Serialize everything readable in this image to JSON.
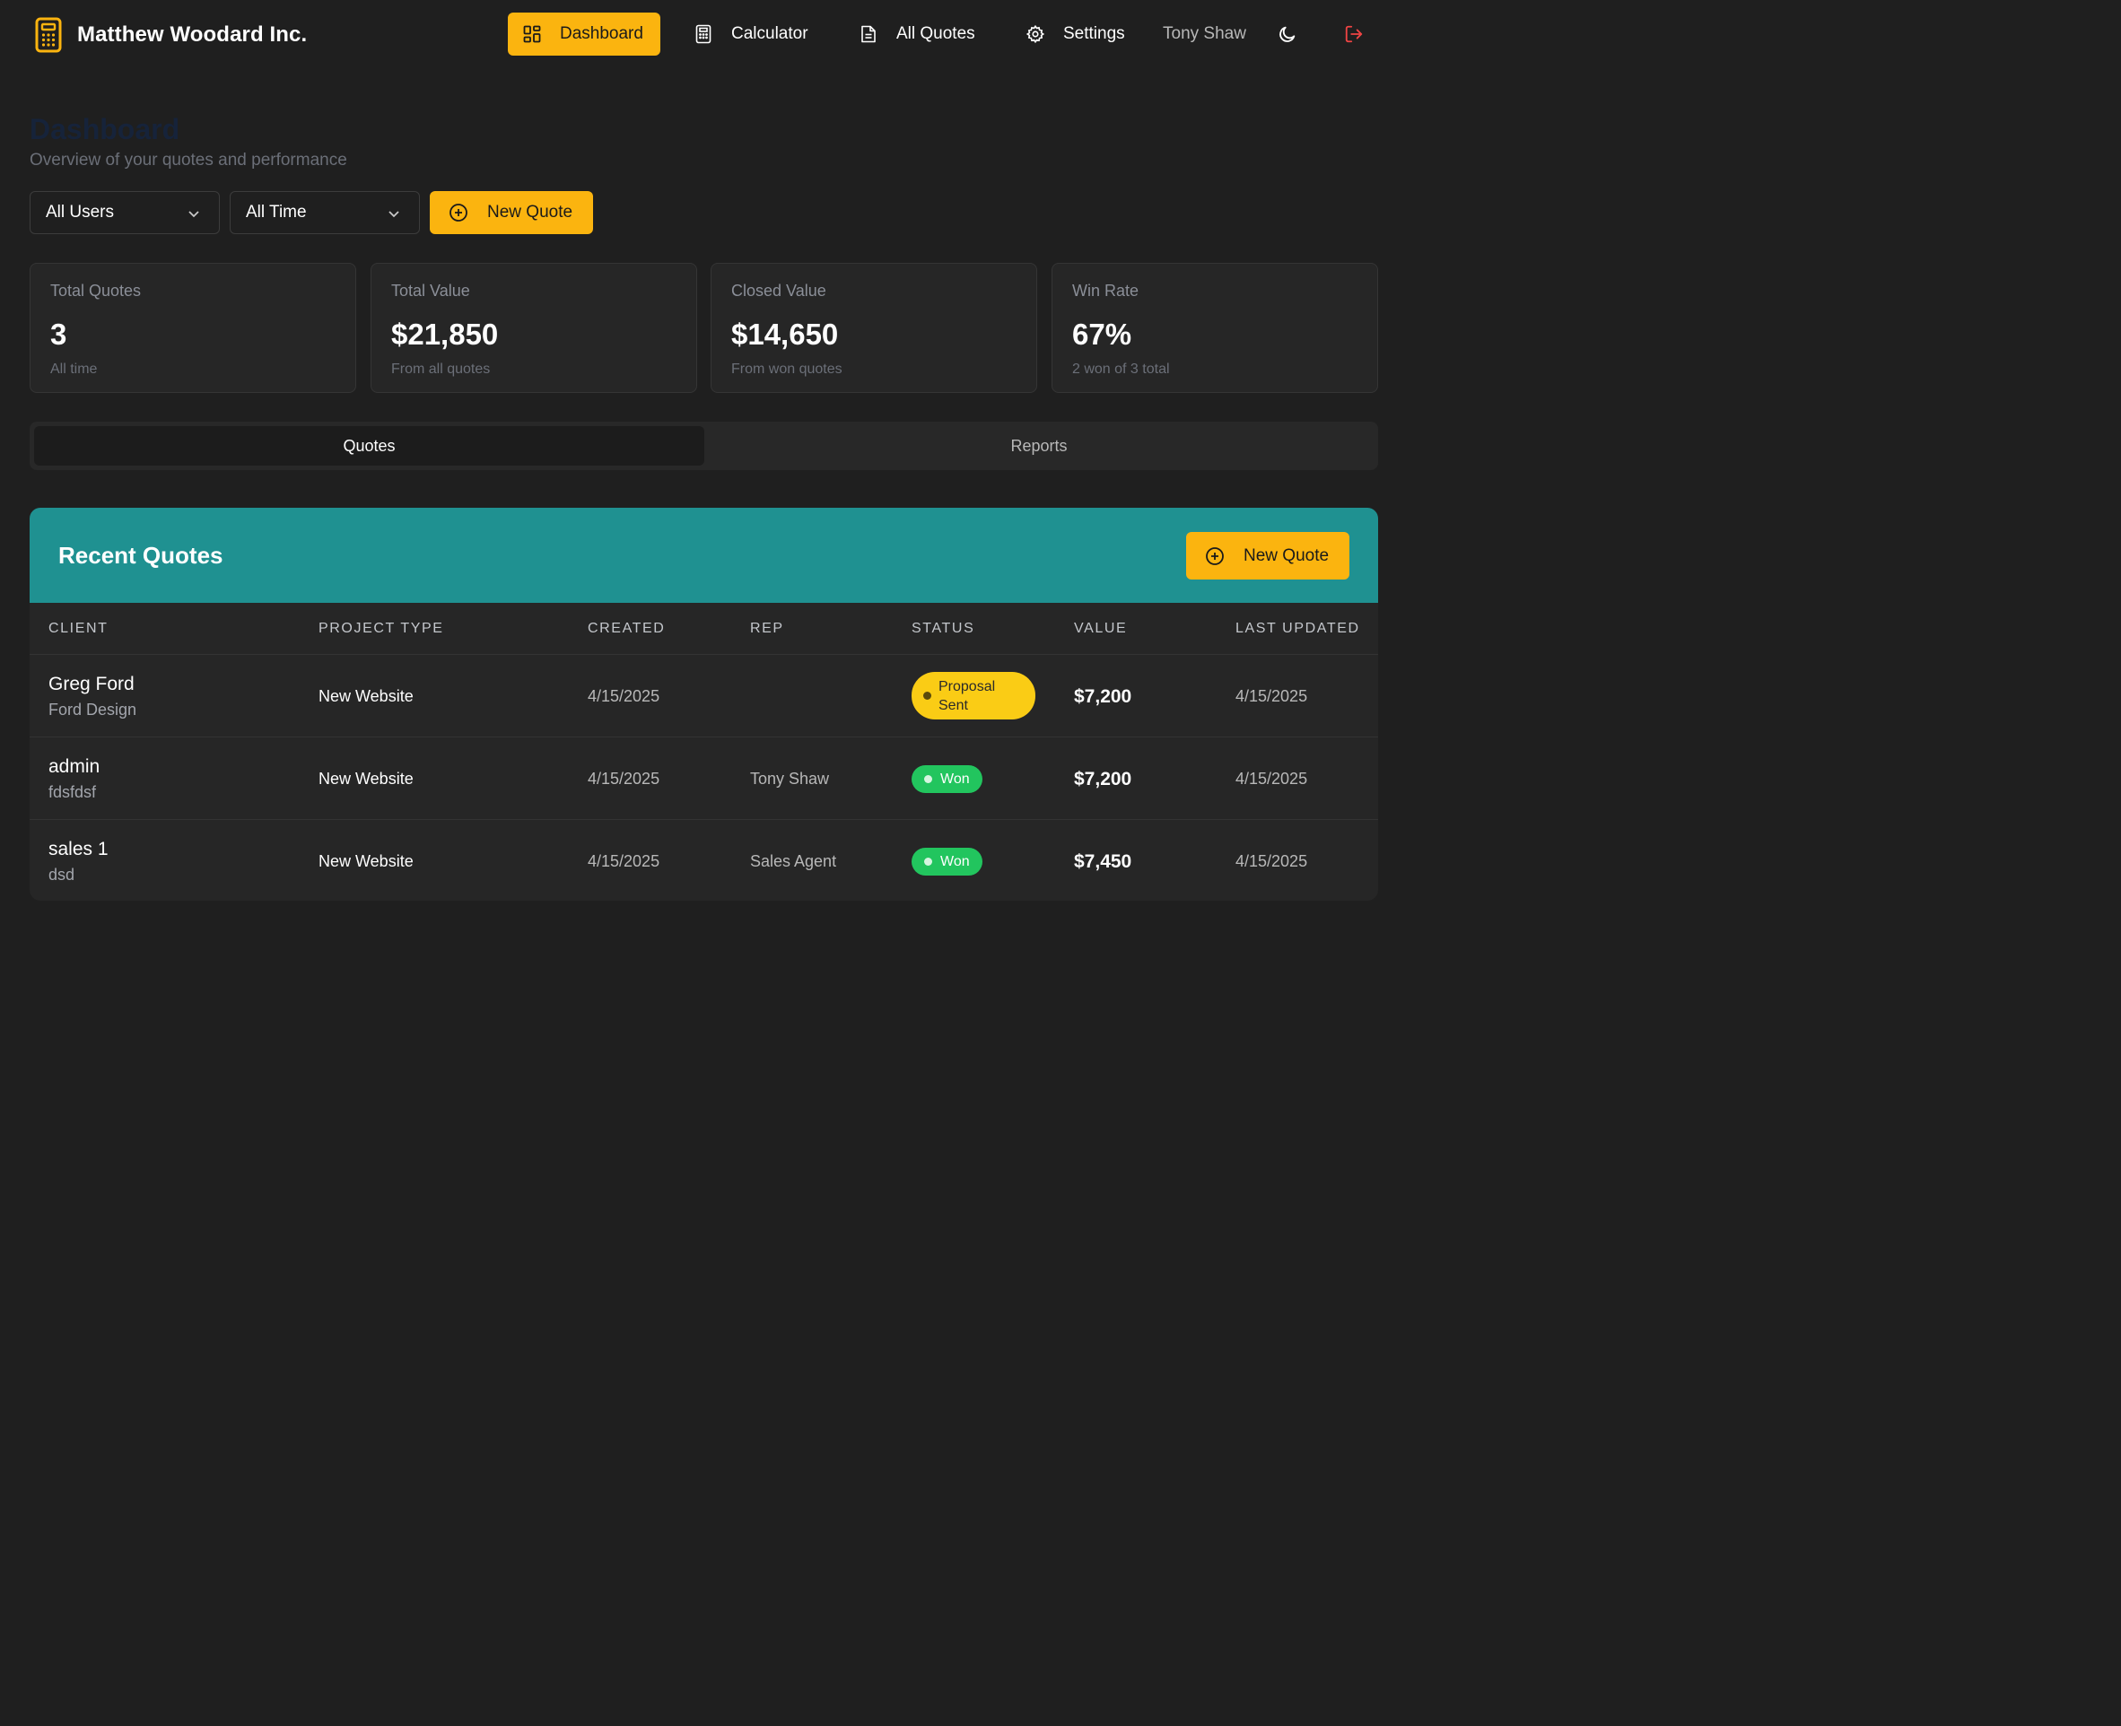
{
  "brand": {
    "name": "Matthew Woodard Inc.",
    "icon": "calculator-icon"
  },
  "nav": {
    "dashboard": "Dashboard",
    "calculator": "Calculator",
    "all_quotes": "All Quotes",
    "settings": "Settings",
    "user": "Tony Shaw"
  },
  "page": {
    "title": "Dashboard",
    "subtitle": "Overview of your quotes and performance"
  },
  "filters": {
    "users": "All Users",
    "time": "All Time",
    "new_quote": "New Quote"
  },
  "stats": [
    {
      "label": "Total Quotes",
      "value": "3",
      "note": "All time"
    },
    {
      "label": "Total Value",
      "value": "$21,850",
      "note": "From all quotes"
    },
    {
      "label": "Closed Value",
      "value": "$14,650",
      "note": "From won quotes"
    },
    {
      "label": "Win Rate",
      "value": "67%",
      "note": "2 won of 3 total"
    }
  ],
  "tabs": {
    "quotes": "Quotes",
    "reports": "Reports"
  },
  "panel": {
    "title": "Recent Quotes",
    "new_quote": "New Quote",
    "columns": [
      "CLIENT",
      "PROJECT TYPE",
      "CREATED",
      "REP",
      "STATUS",
      "VALUE",
      "LAST UPDATED"
    ],
    "rows": [
      {
        "client": "Greg Ford",
        "company": "Ford Design",
        "type": "New Website",
        "created": "4/15/2025",
        "rep": "",
        "status": "Proposal Sent",
        "value": "$7,200",
        "updated": "4/15/2025"
      },
      {
        "client": "admin",
        "company": "fdsfdsf",
        "type": "New Website",
        "created": "4/15/2025",
        "rep": "Tony Shaw",
        "status": "Won",
        "value": "$7,200",
        "updated": "4/15/2025"
      },
      {
        "client": "sales 1",
        "company": "dsd",
        "type": "New Website",
        "created": "4/15/2025",
        "rep": "Sales Agent",
        "status": "Won",
        "value": "$7,450",
        "updated": "4/15/2025"
      }
    ]
  },
  "colors": {
    "accent": "#fbb40f",
    "panel_header": "#1f9191",
    "won": "#22c55e",
    "proposal": "#facc15",
    "logout": "#ef4444"
  }
}
